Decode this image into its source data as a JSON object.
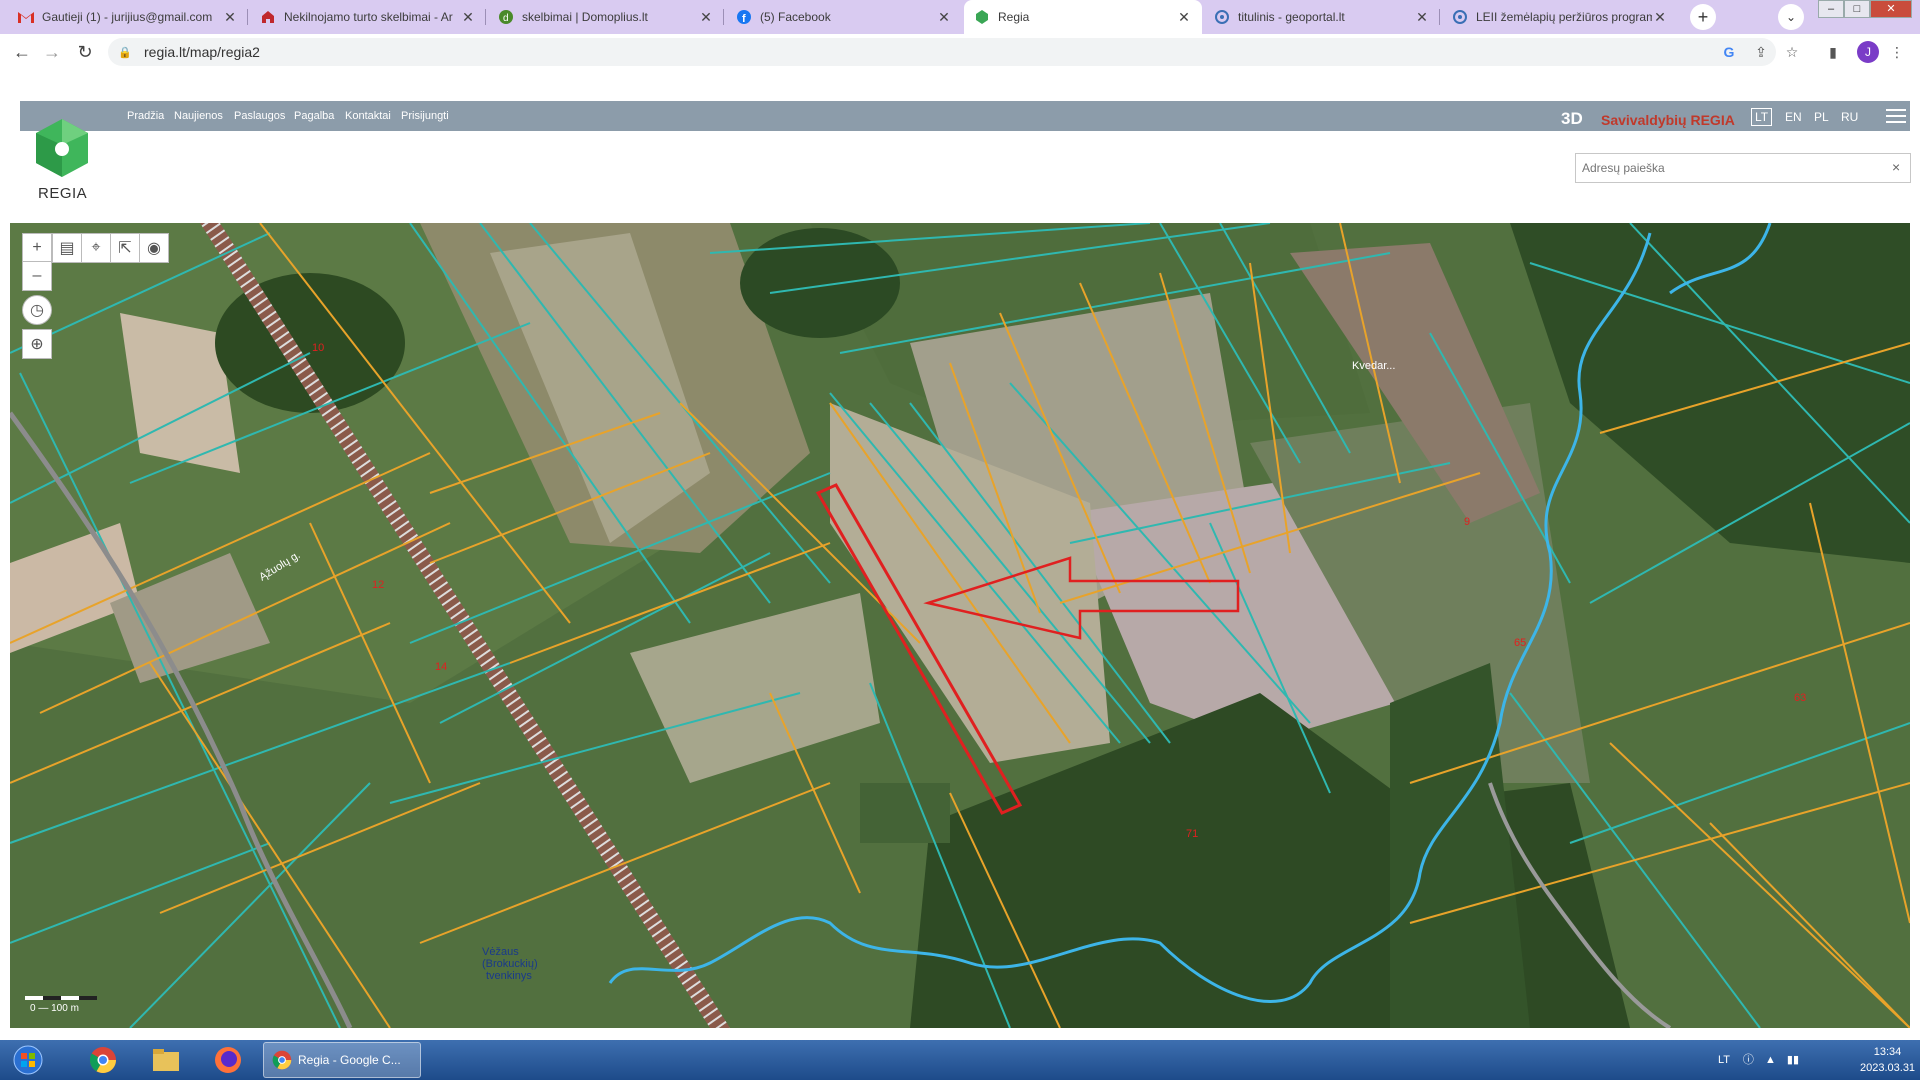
{
  "browser": {
    "tabs": [
      {
        "title": "Gautieji (1) - jurijius@gmail.com",
        "icon": "gmail-icon",
        "active": false
      },
      {
        "title": "Nekilnojamo turto skelbimai - Ar",
        "icon": "aruodas-icon",
        "active": false
      },
      {
        "title": "skelbimai | Domoplius.lt",
        "icon": "domoplius-icon",
        "active": false
      },
      {
        "title": "(5) Facebook",
        "icon": "facebook-icon",
        "active": false
      },
      {
        "title": "Regia",
        "icon": "regia-icon",
        "active": true
      },
      {
        "title": "titulinis - geoportal.lt",
        "icon": "geoportal-icon",
        "active": false
      },
      {
        "title": "LEII žemėlapių peržiūros program",
        "icon": "geoportal-icon",
        "active": false
      }
    ],
    "new_tab_label": "+",
    "url": "regia.lt/map/regia2",
    "profile_initial": "J",
    "window_controls": {
      "minimize": "–",
      "maximize": "□",
      "close": "✕"
    }
  },
  "site": {
    "menu": [
      "Pradžia",
      "Naujienos",
      "Paslaugos",
      "Pagalba",
      "Kontaktai",
      "Prisijungti"
    ],
    "logo_text": "REGIA",
    "brand_3d": "3D",
    "brand_name": "Savivaldybių REGIA",
    "languages": [
      "LT",
      "EN",
      "PL",
      "RU"
    ],
    "selected_language": "LT",
    "search_placeholder": "Adresų paieška",
    "search_clear": "×"
  },
  "map": {
    "controls": [
      "zoom-in",
      "zoom-out",
      "basemap",
      "location-pin",
      "share",
      "layers",
      "history",
      "my-location"
    ],
    "labels": [
      {
        "text": "10"
      },
      {
        "text": "12"
      },
      {
        "text": "14"
      },
      {
        "text": "9"
      },
      {
        "text": "65"
      },
      {
        "text": "63"
      },
      {
        "text": "71"
      },
      {
        "text": "Kvedar..."
      },
      {
        "text": "Ąžuolų g."
      },
      {
        "text": "Vėžaus"
      },
      {
        "text": "(Brokuckių)"
      },
      {
        "text": "tvenkinys"
      }
    ],
    "scale_label": "0 — 100 m",
    "colors": {
      "parcel_cadastral": "#e8a32a",
      "parcel_boundary": "#2fb8b0",
      "selected_parcel": "#e02020",
      "river": "#3db5e8"
    }
  },
  "taskbar": {
    "apps": [
      "start-orb",
      "chrome-icon",
      "explorer-icon",
      "firefox-icon"
    ],
    "active_task": "Regia - Google C...",
    "tray_language": "LT",
    "time": "13:34",
    "date": "2023.03.31"
  }
}
